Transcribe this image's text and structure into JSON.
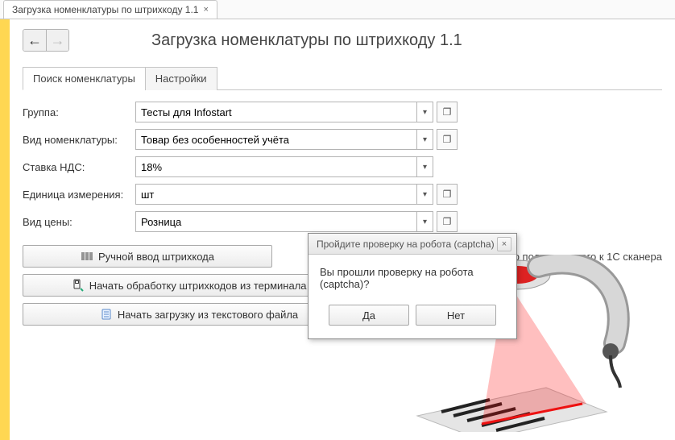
{
  "window_tab": {
    "title": "Загрузка номенклатуры по штрихкоду 1.1"
  },
  "nav": {
    "back": "←",
    "forward": "→"
  },
  "page_title": "Загрузка номенклатуры по штрихкоду 1.1",
  "inner_tabs": {
    "search": "Поиск номенклатуры",
    "settings": "Настройки"
  },
  "fields": {
    "group": {
      "label": "Группа:",
      "value": "Тесты для Infostart"
    },
    "kind": {
      "label": "Вид номенклатуры:",
      "value": "Товар без особенностей учёта"
    },
    "vat": {
      "label": "Ставка НДС:",
      "value": "18%"
    },
    "unit": {
      "label": "Единица измерения:",
      "value": "шт"
    },
    "price": {
      "label": "Вид цены:",
      "value": "Розница"
    }
  },
  "buttons": {
    "manual": "Ручной ввод штрихкода",
    "hint_suffix": "о подключенного к 1С сканера",
    "terminal": "Начать обработку штрихкодов из терминала сбо",
    "textfile": "Начать загрузку из текстового файла"
  },
  "dialog": {
    "title": "Пройдите проверку на робота (captcha)",
    "message": "Вы прошли проверку на робота (captcha)?",
    "yes": "Да",
    "no": "Нет"
  },
  "glyphs": {
    "close": "×",
    "dropdown": "▾",
    "open": "❐"
  }
}
